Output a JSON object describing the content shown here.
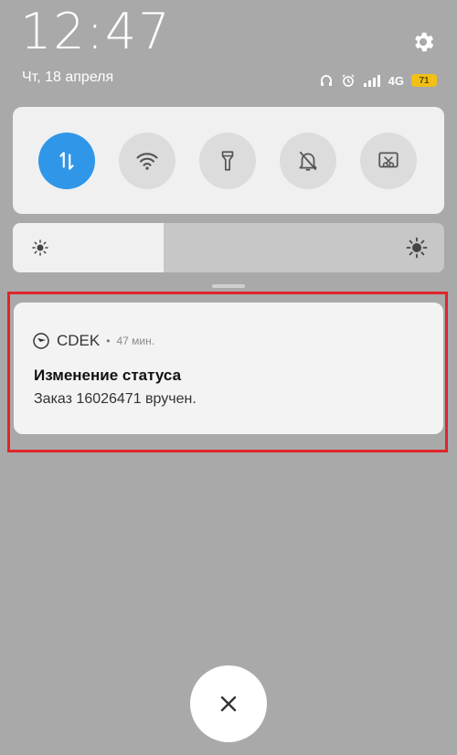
{
  "status_bar": {
    "time": "12:47",
    "date": "Чт, 18 апреля",
    "network": "4G",
    "battery": "71"
  },
  "quick_settings": {
    "toggles": [
      {
        "icon": "data-transfer-icon",
        "active": true
      },
      {
        "icon": "wifi-icon",
        "active": false
      },
      {
        "icon": "flashlight-icon",
        "active": false
      },
      {
        "icon": "mute-bell-icon",
        "active": false
      },
      {
        "icon": "screenshot-icon",
        "active": false
      }
    ],
    "brightness_level": 0.35
  },
  "notification": {
    "app_name": "CDEK",
    "separator": "•",
    "time": "47 мин.",
    "title": "Изменение статуса",
    "text": "Заказ 16026471 вручен."
  },
  "colors": {
    "accent": "#2f96e8",
    "highlight": "#e0252b",
    "background": "#a9a9a9"
  }
}
